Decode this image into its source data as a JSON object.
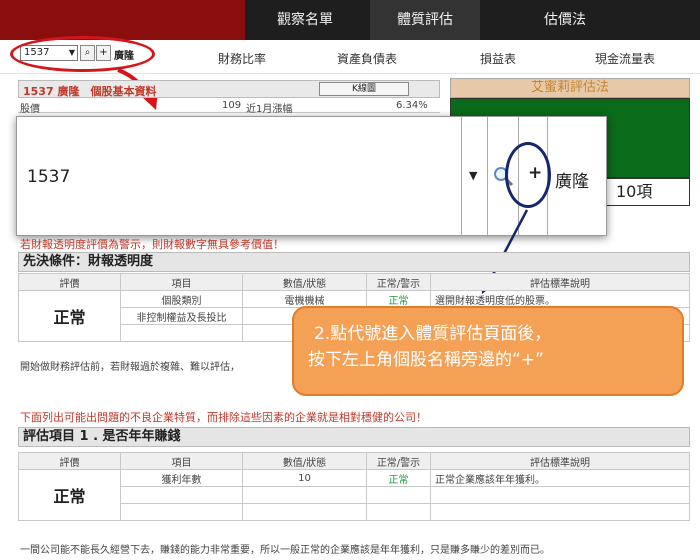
{
  "topnav": {
    "items": [
      {
        "label": "觀察名單"
      },
      {
        "label": "體質評估"
      },
      {
        "label": "估價法"
      }
    ]
  },
  "subbar": {
    "stock_select_value": "1537",
    "stock_name": "廣隆",
    "tabs": [
      "財務比率",
      "資產負債表",
      "損益表",
      "現金流量表"
    ]
  },
  "info": {
    "title": "1537 廣隆　個股基本資料",
    "kline_button": "K線圖",
    "row": {
      "label": "股價",
      "value": "109",
      "label2": "近1月漲幅",
      "value2": "6.34%"
    }
  },
  "right_panel": {
    "title": "艾蜜莉評估法",
    "count": "10項"
  },
  "zoom": {
    "stock_value": "1537",
    "plus": "+",
    "stock_name": "廣隆"
  },
  "warning": "若財報透明度評價為警示，則財報數字無具參考價值！",
  "section1": {
    "title": "先決條件：財報透明度",
    "headers": [
      "評價",
      "項目",
      "數值/狀態",
      "正常/警示",
      "評估標準說明"
    ],
    "evaluation": "正常",
    "rows": [
      {
        "item": "個股類別",
        "value": "電機機械",
        "status": "正常",
        "desc": "選開財報透明度低的股票。"
      },
      {
        "item": "非控制權益及長投比",
        "value": "",
        "status": "",
        "desc": ""
      }
    ],
    "note": "開始做財務評估前，若財報過於複雜、難以評估，"
  },
  "red_line": "下面列出可能出問題的不良企業特質，而排除這些因素的企業就是相對穩健的公司！",
  "section2": {
    "title": "評估項目 1 . 是否年年賺錢",
    "headers": [
      "評價",
      "項目",
      "數值/狀態",
      "正常/警示",
      "評估標準說明"
    ],
    "evaluation": "正常",
    "rows": [
      {
        "item": "獲利年數",
        "value": "10",
        "status": "正常",
        "desc": "正常企業應該年年獲利。"
      }
    ],
    "note": "一間公司能不能長久經營下去，賺錢的能力非常重要，所以一般正常的企業應該是年年獲利，只是賺多賺少的差別而已。"
  },
  "callout": {
    "line1": "2.點代號進入體質評估頁面後，",
    "line2": "按下左上角個股名稱旁邊的“+”"
  },
  "colors": {
    "nav_bg": "#1e1e1e",
    "brand_red": "#8b0e0e",
    "callout": "#f4a055",
    "ok_green": "#1c9b3a",
    "warn_red": "#c0392b"
  }
}
